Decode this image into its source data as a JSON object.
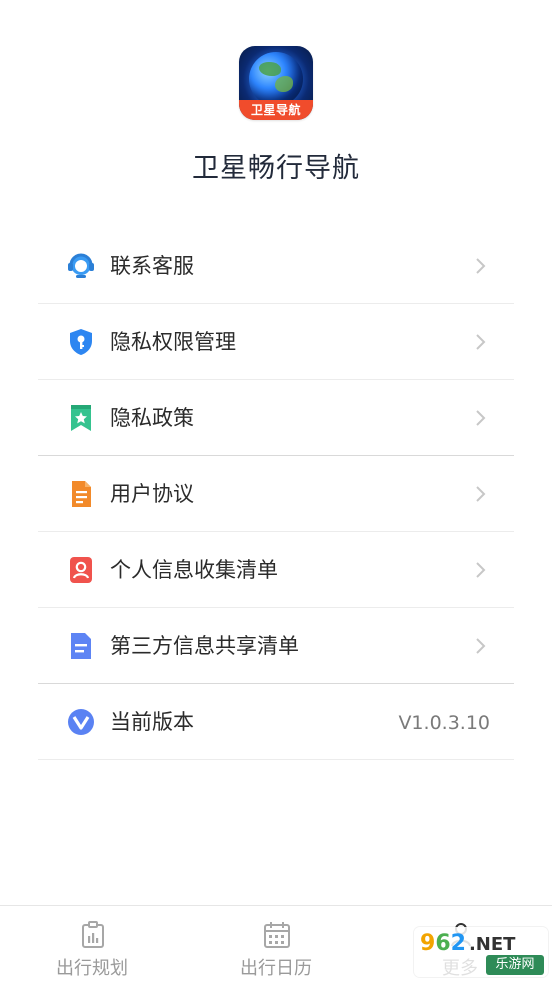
{
  "app": {
    "icon_badge_text": "卫星导航",
    "title": "卫星畅行导航"
  },
  "menu": {
    "items": [
      {
        "label": "联系客服",
        "icon": "customer-service-icon",
        "color": "#3a9bf3"
      },
      {
        "label": "隐私权限管理",
        "icon": "shield-key-icon",
        "color": "#2d86f1"
      },
      {
        "label": "隐私政策",
        "icon": "bookmark-star-icon",
        "color": "#35c38f"
      },
      {
        "label": "用户协议",
        "icon": "document-icon",
        "color": "#f28a2a"
      },
      {
        "label": "个人信息收集清单",
        "icon": "user-card-icon",
        "color": "#f0534d"
      },
      {
        "label": "第三方信息共享清单",
        "icon": "doc-lines-icon",
        "color": "#5d84f4"
      },
      {
        "label": "当前版本",
        "icon": "version-v-icon",
        "color": "#5a82f3",
        "value": "V1.0.3.10"
      }
    ]
  },
  "tabbar": {
    "tabs": [
      {
        "label": "出行规划",
        "icon": "clipboard-chart-icon"
      },
      {
        "label": "出行日历",
        "icon": "calendar-icon"
      },
      {
        "label": "更多",
        "icon": "more-icon"
      }
    ]
  },
  "watermark": {
    "digits": [
      "9",
      "6",
      "2"
    ],
    "suffix": ".NET",
    "subtitle": "乐游网"
  }
}
